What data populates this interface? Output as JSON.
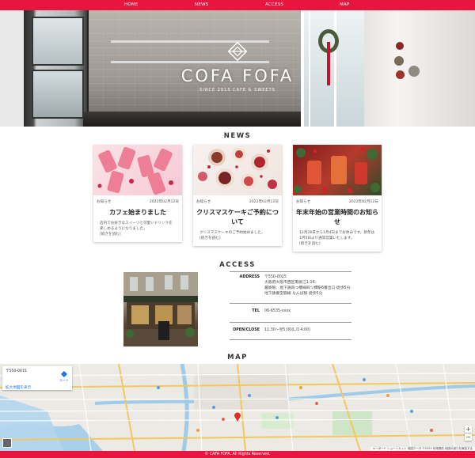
{
  "nav": {
    "items": [
      "HOME",
      "NEWS",
      "ACCESS",
      "MAP"
    ]
  },
  "hero": {
    "brand": "COFA FOFA",
    "subtitle": "SINCE 2015 CAFE & SWEETS"
  },
  "news": {
    "title": "NEWS",
    "cards": [
      {
        "category": "お知らせ",
        "date": "2022年02月12日",
        "title": "カフェ始まりました",
        "body": "店内でお好きなスイーツと可愛いドリンクを楽しめるようになりました。",
        "more": "[続きを読む]"
      },
      {
        "category": "お知らせ",
        "date": "2022年02月12日",
        "title": "クリスマスケーキご予約について",
        "body": "クリスマスケーキのご予約始めました。",
        "more": "[続きを読む]"
      },
      {
        "category": "お知らせ",
        "date": "2022年02月12日",
        "title": "年末年始の営業時間のお知らせ",
        "body": "12月28日から1月4日までお休みです。新年は1月5日より通常営業いたします。",
        "more": "[続きを読む]"
      }
    ]
  },
  "access": {
    "title": "ACCESS",
    "rows": [
      {
        "key": "ADDRESS",
        "lines": [
          "〒550-0015",
          "大阪府大阪市西区南堀江1-16-",
          "最寄駅：地下鉄四つ橋線四ツ橋駅6番出口 徒歩5分",
          "地下鉄御堂筋線 なんば駅 徒歩5分"
        ]
      },
      {
        "key": "TEL",
        "lines": [
          "06-6535-xxxx"
        ]
      },
      {
        "key": "OPEN/CLOSE",
        "lines": [
          "11:30〜翌5:00(L.O.4:00)"
        ]
      }
    ]
  },
  "map": {
    "title": "MAP",
    "card_address": "〒550-0015",
    "card_link": "拡大地図を表示",
    "route_label": "ルート",
    "zoom_in": "+",
    "zoom_out": "−",
    "attribution": "キーボード ショートカット  地図データ ©2022  利用規約  地図の誤りを報告する"
  },
  "footer": {
    "text": "© CAFA FOFA. All Rights Reserved."
  },
  "colors": {
    "accent": "#e8163f",
    "link": "#1a73e8"
  }
}
